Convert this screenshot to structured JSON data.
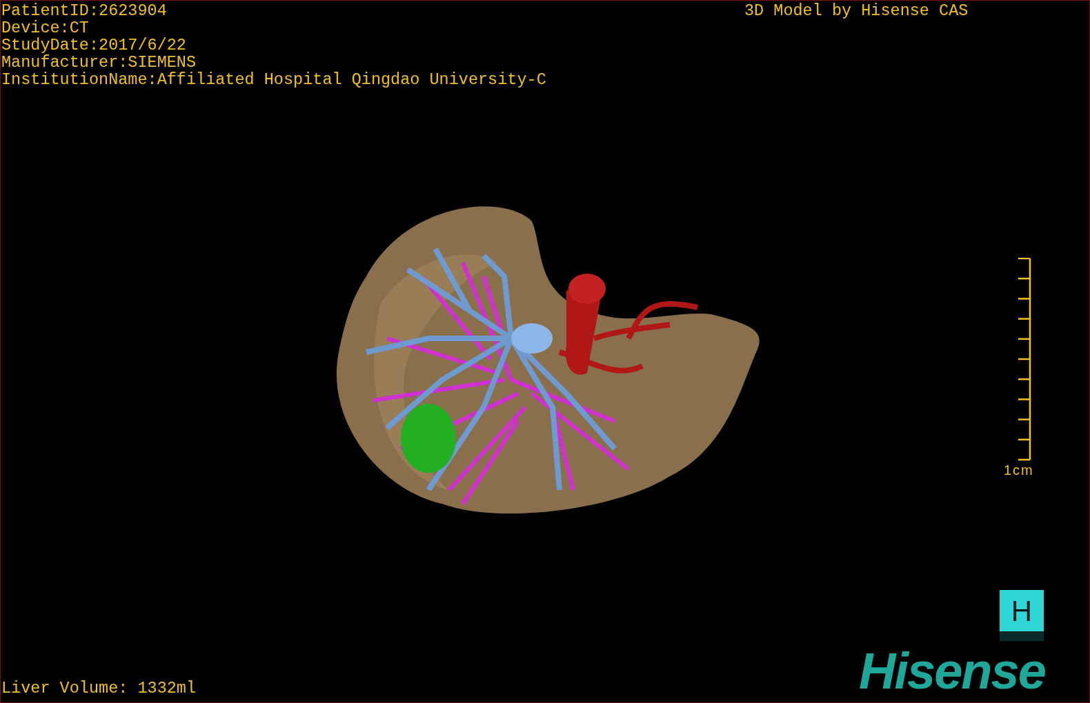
{
  "info_lines": [
    "PatientID:2623904",
    "Device:CT",
    "StudyDate:2017/6/22",
    "Manufacturer:SIEMENS",
    "InstitutionName:Affiliated Hospital Qingdao University-C"
  ],
  "model_credit": "3D Model by Hisense CAS",
  "scale_bar": {
    "label": "1cm"
  },
  "liver_volume": "Liver Volume: 1332ml",
  "logo": {
    "badge": "H",
    "wordmark": "Hisense"
  }
}
